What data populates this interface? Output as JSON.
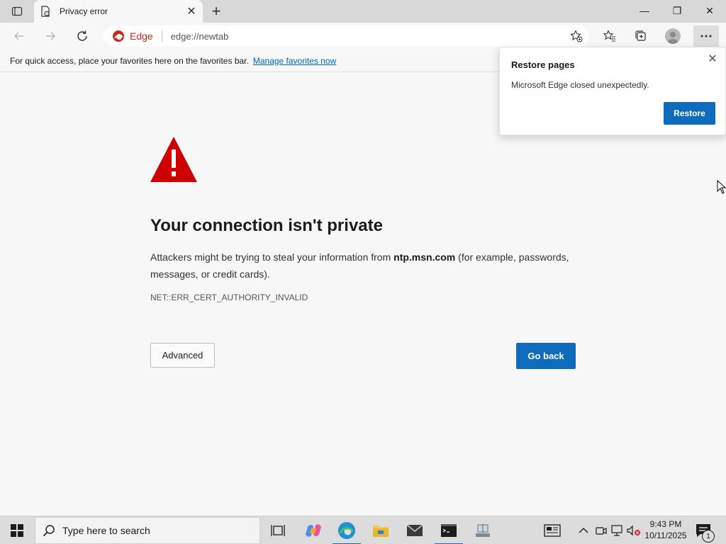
{
  "tab": {
    "title": "Privacy error",
    "close": "✕"
  },
  "new_tab": "+",
  "window_controls": {
    "minimize": "—",
    "restore": "❐",
    "close": "✕"
  },
  "address": {
    "badge": "Edge",
    "url": "edge://newtab"
  },
  "favorites_bar": {
    "text": "For quick access, place your favorites here on the favorites bar.",
    "link": "Manage favorites now"
  },
  "error": {
    "heading": "Your connection isn't private",
    "desc_prefix": "Attackers might be trying to steal your information from ",
    "host": "ntp.msn.com",
    "desc_suffix": " (for example, passwords, messages, or credit cards).",
    "code": "NET::ERR_CERT_AUTHORITY_INVALID",
    "advanced_label": "Advanced",
    "go_back_label": "Go back"
  },
  "restore_popup": {
    "title": "Restore pages",
    "message": "Microsoft Edge closed unexpectedly.",
    "restore_label": "Restore",
    "close": "✕"
  },
  "taskbar": {
    "search_placeholder": "Type here to search",
    "time": "9:43 PM",
    "date": "10/11/2025",
    "notification_count": "1",
    "apps": [
      "task-view",
      "copilot",
      "edge",
      "file-explorer",
      "mail",
      "terminal",
      "remote-desktop"
    ]
  },
  "colors": {
    "accent": "#0f6cbd",
    "warning_red": "#cc0000",
    "edge_red": "#c42b1c"
  }
}
